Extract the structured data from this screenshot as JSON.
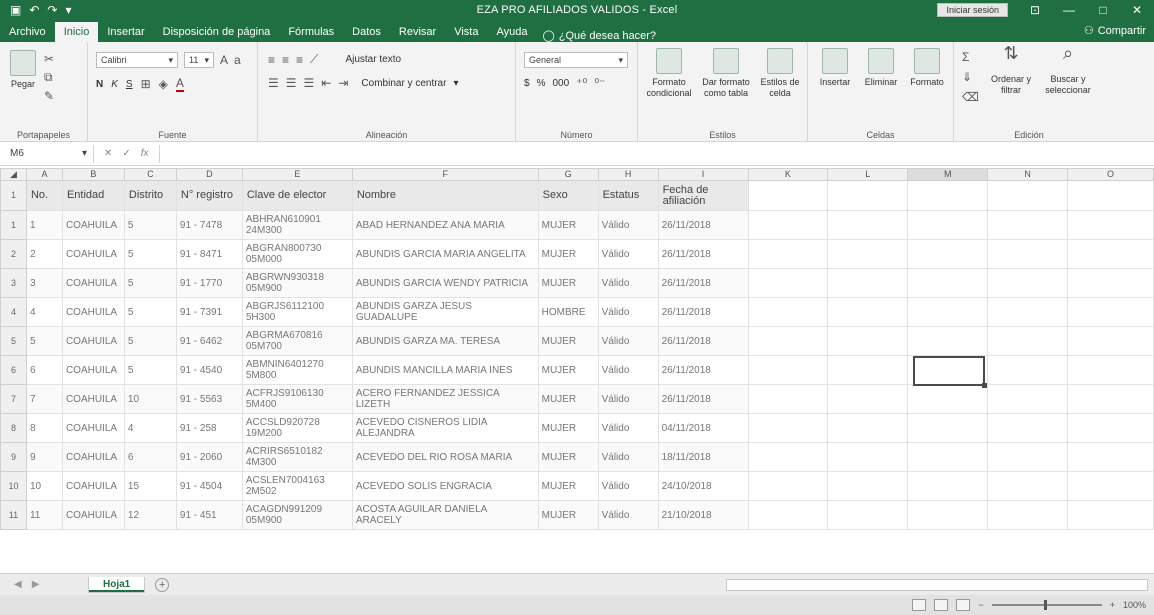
{
  "window": {
    "title": "EZA PRO AFILIADOS VALIDOS  -  Excel",
    "signin": "Iniciar sesión",
    "controls": [
      "—",
      "□",
      "✕"
    ]
  },
  "ribbon_tabs": [
    "Archivo",
    "Inicio",
    "Insertar",
    "Disposición de página",
    "Fórmulas",
    "Datos",
    "Revisar",
    "Vista",
    "Ayuda"
  ],
  "tell_me": "¿Qué desea hacer?",
  "share": "Compartir",
  "ribbon": {
    "clipboard": {
      "paste": "Pegar",
      "label": "Portapapeles"
    },
    "font": {
      "name": "Calibri",
      "size": "11",
      "label": "Fuente",
      "bold": "N",
      "italic": "K",
      "underline": "S"
    },
    "alignment": {
      "wrap": "Ajustar texto",
      "merge": "Combinar y centrar",
      "label": "Alineación"
    },
    "number": {
      "format": "General",
      "currency": "$",
      "percent": "%",
      "thousands": "000",
      "label": "Número"
    },
    "styles": {
      "conditional": "Formato condicional",
      "table": "Dar formato como tabla",
      "cell": "Estilos de celda",
      "label": "Estilos"
    },
    "cells": {
      "insert": "Insertar",
      "delete": "Eliminar",
      "format": "Formato",
      "label": "Celdas"
    },
    "editing": {
      "sort": "Ordenar y filtrar",
      "find": "Buscar y seleccionar",
      "label": "Edición"
    }
  },
  "formula_bar": {
    "name_box": "M6",
    "fx": "fx",
    "value": ""
  },
  "columns": [
    "A",
    "B",
    "C",
    "D",
    "E",
    "F",
    "G",
    "H",
    "I",
    "K",
    "L",
    "M",
    "N",
    "O"
  ],
  "headers": [
    "No.",
    "Entidad",
    "Distrito",
    "N° registro",
    "Clave de elector",
    "Nombre",
    "Sexo",
    "Estatus",
    "Fecha de afiliación"
  ],
  "rows": [
    {
      "n": "1",
      "no": "1",
      "entidad": "COAHUILA",
      "distrito": "5",
      "registro": "91 - 7478",
      "clave": "ABHRAN610901 24M300",
      "nombre": "ABAD HERNANDEZ ANA MARIA",
      "sexo": "MUJER",
      "estatus": "Válido",
      "fecha": "26/11/2018"
    },
    {
      "n": "2",
      "no": "2",
      "entidad": "COAHUILA",
      "distrito": "5",
      "registro": "91 - 8471",
      "clave": "ABGRAN800730 05M000",
      "nombre": "ABUNDIS GARCIA MARIA ANGELITA",
      "sexo": "MUJER",
      "estatus": "Válido",
      "fecha": "26/11/2018"
    },
    {
      "n": "3",
      "no": "3",
      "entidad": "COAHUILA",
      "distrito": "5",
      "registro": "91 - 1770",
      "clave": "ABGRWN930318 05M900",
      "nombre": "ABUNDIS GARCIA WENDY PATRICIA",
      "sexo": "MUJER",
      "estatus": "Válido",
      "fecha": "26/11/2018"
    },
    {
      "n": "4",
      "no": "4",
      "entidad": "COAHUILA",
      "distrito": "5",
      "registro": "91 - 7391",
      "clave": "ABGRJS6112100 5H300",
      "nombre": "ABUNDIS GARZA JESUS GUADALUPE",
      "sexo": "HOMBRE",
      "estatus": "Válido",
      "fecha": "26/11/2018"
    },
    {
      "n": "5",
      "no": "5",
      "entidad": "COAHUILA",
      "distrito": "5",
      "registro": "91 - 6462",
      "clave": "ABGRMA670816 05M700",
      "nombre": "ABUNDIS GARZA MA. TERESA",
      "sexo": "MUJER",
      "estatus": "Válido",
      "fecha": "26/11/2018"
    },
    {
      "n": "6",
      "no": "6",
      "entidad": "COAHUILA",
      "distrito": "5",
      "registro": "91 - 4540",
      "clave": "ABMNIN6401270 5M800",
      "nombre": "ABUNDIS MANCILLA MARIA INES",
      "sexo": "MUJER",
      "estatus": "Válido",
      "fecha": "26/11/2018"
    },
    {
      "n": "7",
      "no": "7",
      "entidad": "COAHUILA",
      "distrito": "10",
      "registro": "91 - 5563",
      "clave": "ACFRJS9106130 5M400",
      "nombre": "ACERO FERNANDEZ JESSICA LIZETH",
      "sexo": "MUJER",
      "estatus": "Válido",
      "fecha": "26/11/2018"
    },
    {
      "n": "8",
      "no": "8",
      "entidad": "COAHUILA",
      "distrito": "4",
      "registro": "91 - 258",
      "clave": "ACCSLD920728 19M200",
      "nombre": "ACEVEDO CISNEROS LIDIA ALEJANDRA",
      "sexo": "MUJER",
      "estatus": "Válido",
      "fecha": "04/11/2018"
    },
    {
      "n": "9",
      "no": "9",
      "entidad": "COAHUILA",
      "distrito": "6",
      "registro": "91 - 2060",
      "clave": "ACRIRS6510182 4M300",
      "nombre": "ACEVEDO DEL RIO ROSA MARIA",
      "sexo": "MUJER",
      "estatus": "Válido",
      "fecha": "18/11/2018"
    },
    {
      "n": "10",
      "no": "10",
      "entidad": "COAHUILA",
      "distrito": "15",
      "registro": "91 - 4504",
      "clave": "ACSLEN7004163 2M502",
      "nombre": "ACEVEDO SOLIS ENGRACIA",
      "sexo": "MUJER",
      "estatus": "Válido",
      "fecha": "24/10/2018"
    },
    {
      "n": "11",
      "no": "11",
      "entidad": "COAHUILA",
      "distrito": "12",
      "registro": "91 - 451",
      "clave": "ACAGDN991209 05M900",
      "nombre": "ACOSTA AGUILAR DANIELA ARACELY",
      "sexo": "MUJER",
      "estatus": "Válido",
      "fecha": "21/10/2018"
    }
  ],
  "sheet_tabs": [
    "Hoja1"
  ],
  "status": {
    "zoom": "100%"
  }
}
